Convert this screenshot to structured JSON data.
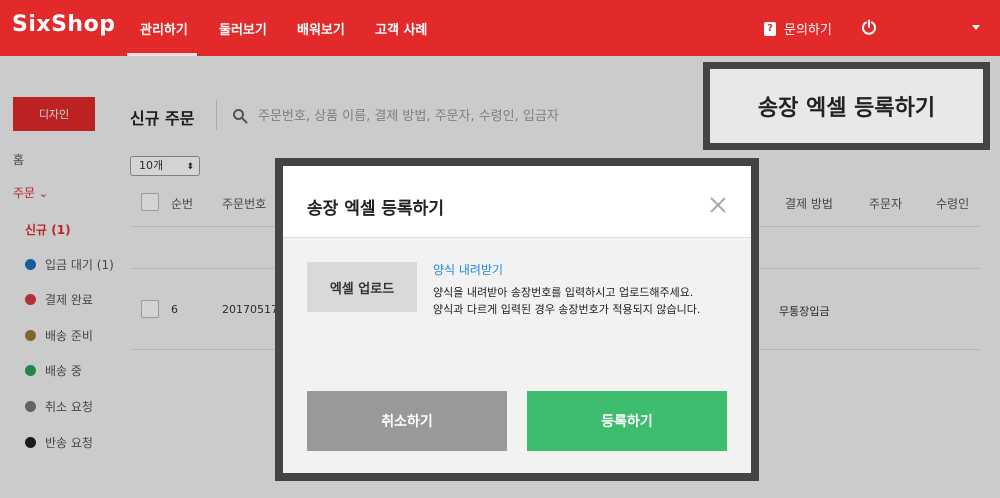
{
  "header": {
    "logo": "SixShop",
    "nav": [
      "관리하기",
      "둘러보기",
      "배워보기",
      "고객 사례"
    ],
    "help_label": "문의하기",
    "help_glyph": "?"
  },
  "sidebar": {
    "design_button": "디자인",
    "home": "홈",
    "orders": "주문",
    "orders_caret": "⌄",
    "new_orders": "신규  (1)",
    "items": [
      {
        "label": "입금 대기  (1)",
        "color": "#1e6fbf"
      },
      {
        "label": "결제 완료",
        "color": "#d9374b"
      },
      {
        "label": "배송 준비",
        "color": "#9a7a3a"
      },
      {
        "label": "배송 중",
        "color": "#2aa35a"
      },
      {
        "label": "취소 요청",
        "color": "#777777"
      },
      {
        "label": "반송 요청",
        "color": "#222222"
      }
    ]
  },
  "main": {
    "title": "신규 주문",
    "search_placeholder": "주문번호, 상품 이름, 결제 방법, 주문자, 수령인, 입금자",
    "count_select": "10개",
    "count_arrow": "⬍",
    "columns": {
      "seq": "순번",
      "order_no": "주문번호",
      "pay_method": "결제 방법",
      "orderer": "주문자",
      "receiver": "수령인"
    },
    "row": {
      "seq": "6",
      "order_no": "20170517",
      "pay_method": "무통장입금"
    }
  },
  "callout": {
    "text": "송장 엑셀 등록하기"
  },
  "modal": {
    "title": "송장 엑셀 등록하기",
    "upload_button": "엑셀 업로드",
    "download_link": "양식 내려받기",
    "help_line1": "양식을 내려받아 송장번호를 입력하시고 업로드해주세요.",
    "help_line2": "양식과 다르게 입력된 경우 송장번호가 적용되지 않습니다.",
    "cancel_button": "취소하기",
    "submit_button": "등록하기"
  },
  "colors": {
    "brand": "#e22a2a",
    "submit": "#3dbd6e",
    "cancel": "#999999",
    "link": "#1e88e5"
  }
}
